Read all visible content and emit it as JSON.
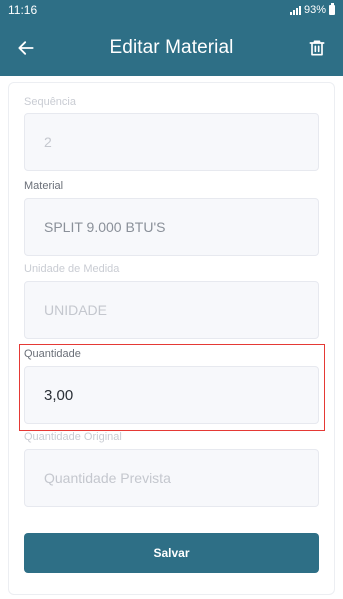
{
  "status_bar": {
    "time": "11:16",
    "battery_level": "93%"
  },
  "app_bar": {
    "title": "Editar Material",
    "back_icon": "arrow-left-icon",
    "delete_icon": "trash-icon",
    "color": "#2e6f86"
  },
  "form": {
    "sequencia": {
      "label": "Sequência",
      "value": "2"
    },
    "material": {
      "label": "Material",
      "value": "SPLIT 9.000 BTU'S"
    },
    "unidade": {
      "label": "Unidade de Medida",
      "value": "UNIDADE"
    },
    "quantidade": {
      "label": "Quantidade",
      "value": "3,00"
    },
    "quantidade_original": {
      "label": "Quantidade Original",
      "placeholder": "Quantidade Prevista"
    }
  },
  "save_label": "Salvar",
  "highlight_color": "#e53935"
}
